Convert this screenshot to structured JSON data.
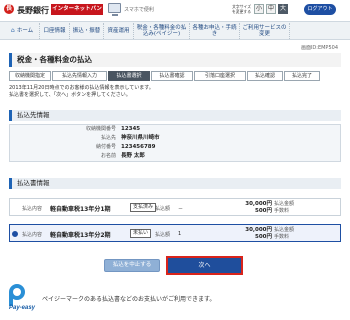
{
  "header": {
    "bank_name": "長野銀行",
    "ib_badge": "インターネットバンキング",
    "logo_char": "長",
    "note": "スマホで便利",
    "fontsize_label": "文字サイズを変更する",
    "fontsize_options": [
      "小",
      "中",
      "大"
    ],
    "fontsize_selected": "大",
    "logout": "ログアウト"
  },
  "nav": {
    "items": [
      {
        "label": "ホーム",
        "icon": "home-icon"
      },
      {
        "label": "口座情報"
      },
      {
        "label": "振込・振替"
      },
      {
        "label": "資産運用"
      },
      {
        "label": "税金・各種料金の払込み(ペイジー)"
      },
      {
        "label": "各種お申込・手続き"
      },
      {
        "label": "ご利用サービスの変更"
      }
    ]
  },
  "screen_id": "画面ID:EMP504",
  "page_title": "税金・各種料金の払込",
  "steps": [
    "収納機関指定",
    "払込先情報入力",
    "払込書選択",
    "払込書確認",
    "引落口座選択",
    "払込確認",
    "払込完了"
  ],
  "active_step": 2,
  "intro": {
    "line1": "2013年11月20日時点でのお客様の払込情報を表示しています。",
    "line2": "払込書を選択して、「次へ」ボタンを押してください。"
  },
  "payee_section": {
    "heading": "払込先情報",
    "rows": [
      {
        "label": "収納機関番号",
        "value": "12345"
      },
      {
        "label": "払込先",
        "value": "神奈川県川崎市"
      },
      {
        "label": "納付番号",
        "value": "123456789"
      },
      {
        "label": "お名前",
        "value": "長野 太郎"
      }
    ]
  },
  "bill_section": {
    "heading": "払込書情報",
    "rows": [
      {
        "label": "払込内容",
        "name": "軽自動車税13年分1期",
        "state": "支払済み",
        "amt_label": "払込額",
        "amt_value": "－",
        "money1": "30,000円",
        "money1_label": "払込金額",
        "money2": "500円",
        "money2_label": "手数料",
        "selected": false
      },
      {
        "label": "払込内容",
        "name": "軽自動車税13年分2期",
        "state": "未払い",
        "amt_label": "払込額",
        "amt_value": "1",
        "money1": "30,000円",
        "money1_label": "払込金額",
        "money2": "500円",
        "money2_label": "手数料",
        "selected": true
      }
    ]
  },
  "buttons": {
    "cancel": "払込を中止する",
    "next": "次へ"
  },
  "payeasy": {
    "logo_text": "Pay-easy",
    "message": "ペイジーマークのある払込書などのお支払いがご利用できます。"
  }
}
